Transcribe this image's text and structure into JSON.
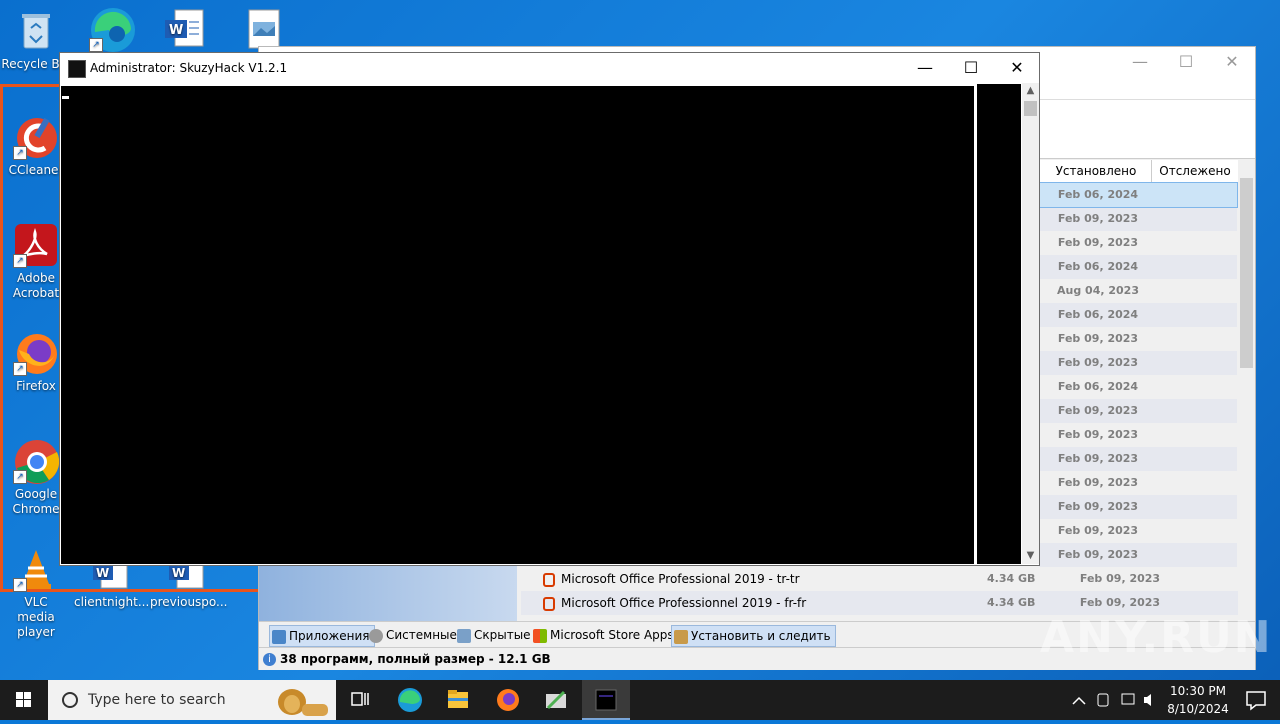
{
  "desktop": {
    "icons": [
      {
        "name": "recycle-bin",
        "label": "Recycle Bin"
      },
      {
        "name": "ccleaner",
        "label": "CCleaner"
      },
      {
        "name": "adobe-acrobat",
        "label": "Adobe Acrobat"
      },
      {
        "name": "firefox",
        "label": "Firefox"
      },
      {
        "name": "google-chrome",
        "label": "Google Chrome"
      },
      {
        "name": "vlc",
        "label": "VLC media player"
      },
      {
        "name": "doc1",
        "label": "clientnight..."
      },
      {
        "name": "doc2",
        "label": "previouspo..."
      }
    ]
  },
  "bg_window": {
    "columns": [
      "Установлено",
      "Отслежено"
    ],
    "dates": [
      "Feb 06, 2024",
      "Feb 09, 2023",
      "Feb 09, 2023",
      "Feb 06, 2024",
      "Aug 04, 2023",
      "Feb 06, 2024",
      "Feb 09, 2023",
      "Feb 09, 2023",
      "Feb 06, 2024",
      "Feb 09, 2023",
      "Feb 09, 2023",
      "Feb 09, 2023",
      "Feb 09, 2023",
      "Feb 09, 2023",
      "Feb 09, 2023",
      "Feb 09, 2023"
    ],
    "programs": [
      {
        "name": "Microsoft Office Professional 2019 - tr-tr",
        "size": "4.34 GB",
        "date": "Feb 09, 2023"
      },
      {
        "name": "Microsoft Office Professionnel 2019 - fr-fr",
        "size": "4.34 GB",
        "date": "Feb 09, 2023"
      }
    ],
    "tabs": [
      "Приложения",
      "Системные",
      "Скрытые",
      "Microsoft Store Apps",
      "Установить и следить"
    ],
    "status_count": "38 программ, полный размер - ",
    "status_size": "12.1 GB"
  },
  "console": {
    "title": "Administrator:  SkuzyHack V1.2.1",
    "min": "—",
    "max": "☐",
    "close": "✕"
  },
  "taskbar": {
    "search_placeholder": "Type here to search",
    "time": "10:30 PM",
    "date": "8/10/2024"
  },
  "watermark": "ANY.RUN"
}
